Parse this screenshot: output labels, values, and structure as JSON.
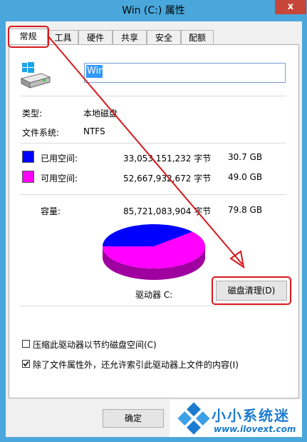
{
  "window": {
    "title": "Win (C:) 属性",
    "close_glyph": "x"
  },
  "tabs": [
    {
      "label": "常规",
      "active": true
    },
    {
      "label": "工具"
    },
    {
      "label": "硬件"
    },
    {
      "label": "共享"
    },
    {
      "label": "安全"
    },
    {
      "label": "配额"
    }
  ],
  "drive": {
    "icon": "windows-drive-icon",
    "name_value": "Win",
    "type_label": "类型:",
    "type_value": "本地磁盘",
    "fs_label": "文件系统:",
    "fs_value": "NTFS"
  },
  "space": {
    "used_label": "已用空间:",
    "used_bytes": "33,053,151,232 字节",
    "used_size": "30.7 GB",
    "free_label": "可用空间:",
    "free_bytes": "52,667,932,672 字节",
    "free_size": "49.0 GB",
    "capacity_label": "容量:",
    "capacity_bytes": "85,721,083,904 字节",
    "capacity_size": "79.8 GB",
    "used_color": "#0000ff",
    "free_color": "#ff00ff"
  },
  "pie": {
    "used_fraction": 0.385,
    "free_fraction": 0.615
  },
  "drive_label": "驱动器 C:",
  "cleanup_button": "磁盘清理(D)",
  "options": [
    {
      "label": "压缩此驱动器以节约磁盘空间(C)",
      "checked": false
    },
    {
      "label": "除了文件属性外，还允许索引此驱动器上文件的内容(I)",
      "checked": true
    }
  ],
  "buttons": {
    "ok": "确定"
  },
  "annotation_color": "#d8171b",
  "watermark": {
    "name": "小小系统迷",
    "url": "www.ilovext.com"
  }
}
